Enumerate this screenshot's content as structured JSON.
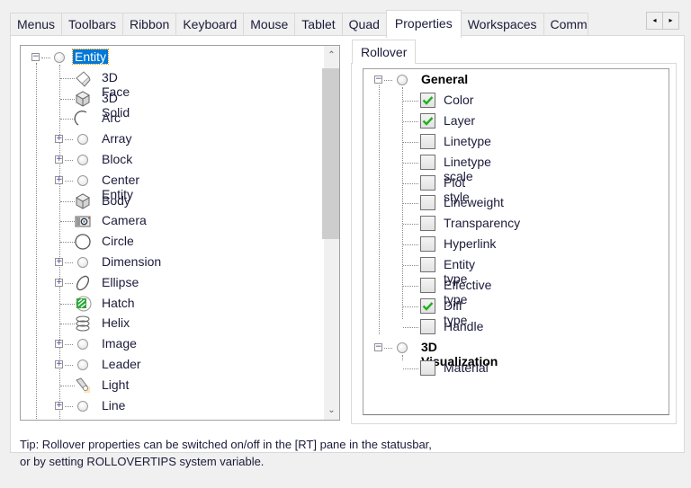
{
  "tabs": [
    {
      "label": "Menus",
      "active": false
    },
    {
      "label": "Toolbars",
      "active": false
    },
    {
      "label": "Ribbon",
      "active": false
    },
    {
      "label": "Keyboard",
      "active": false
    },
    {
      "label": "Mouse",
      "active": false
    },
    {
      "label": "Tablet",
      "active": false
    },
    {
      "label": "Quad",
      "active": false
    },
    {
      "label": "Properties",
      "active": true
    },
    {
      "label": "Workspaces",
      "active": false
    },
    {
      "label": "Comm",
      "active": false
    }
  ],
  "tab_scroll": {
    "left_icon": "◂",
    "right_icon": "▸"
  },
  "entity_tree": {
    "root": {
      "label": "Entity",
      "selected": true,
      "expanded": true,
      "icon": "circle-icon"
    },
    "items": [
      {
        "label": "3D Face",
        "icon": "3dface-icon",
        "expandable": false
      },
      {
        "label": "3D Solid",
        "icon": "3dsolid-icon",
        "expandable": false
      },
      {
        "label": "Arc",
        "icon": "arc-icon",
        "expandable": false
      },
      {
        "label": "Array",
        "icon": "circle-icon",
        "expandable": true
      },
      {
        "label": "Block",
        "icon": "circle-icon",
        "expandable": true
      },
      {
        "label": "Center Entity",
        "icon": "circle-icon",
        "expandable": true
      },
      {
        "label": "Body",
        "icon": "body-icon",
        "expandable": false
      },
      {
        "label": "Camera",
        "icon": "camera-icon",
        "expandable": false
      },
      {
        "label": "Circle",
        "icon": "circle-large-icon",
        "expandable": false
      },
      {
        "label": "Dimension",
        "icon": "circle-icon",
        "expandable": true
      },
      {
        "label": "Ellipse",
        "icon": "ellipse-icon",
        "expandable": true
      },
      {
        "label": "Hatch",
        "icon": "hatch-icon",
        "expandable": false
      },
      {
        "label": "Helix",
        "icon": "helix-icon",
        "expandable": false
      },
      {
        "label": "Image",
        "icon": "circle-icon",
        "expandable": true
      },
      {
        "label": "Leader",
        "icon": "circle-icon",
        "expandable": true
      },
      {
        "label": "Light",
        "icon": "light-icon",
        "expandable": false
      },
      {
        "label": "Line",
        "icon": "circle-icon",
        "expandable": true
      }
    ],
    "scroll": {
      "up_icon": "⌃",
      "down_icon": "⌄",
      "position_fraction": 0.0,
      "visible_fraction": 0.47
    }
  },
  "rollover_tab": {
    "label": "Rollover"
  },
  "rollover_tree": {
    "groups": [
      {
        "label": "General",
        "items": [
          {
            "label": "Color",
            "checked": true
          },
          {
            "label": "Layer",
            "checked": true
          },
          {
            "label": "Linetype",
            "checked": false
          },
          {
            "label": "Linetype scale",
            "checked": false
          },
          {
            "label": "Plot style",
            "checked": false
          },
          {
            "label": "Lineweight",
            "checked": false
          },
          {
            "label": "Transparency",
            "checked": false
          },
          {
            "label": "Hyperlink",
            "checked": false
          },
          {
            "label": "Entity type",
            "checked": false
          },
          {
            "label": "Effective type",
            "checked": false
          },
          {
            "label": "Diff type",
            "checked": true
          },
          {
            "label": "Handle",
            "checked": false
          }
        ]
      },
      {
        "label": "3D Visualization",
        "items": [
          {
            "label": "Material",
            "checked": false
          }
        ]
      }
    ]
  },
  "tip": {
    "line1": "Tip: Rollover properties can be switched on/off in the [RT] pane in the statusbar,",
    "line2": "or by setting ROLLOVERTIPS system variable."
  },
  "colors": {
    "selection": "#0078d7",
    "check": "#22b022"
  }
}
